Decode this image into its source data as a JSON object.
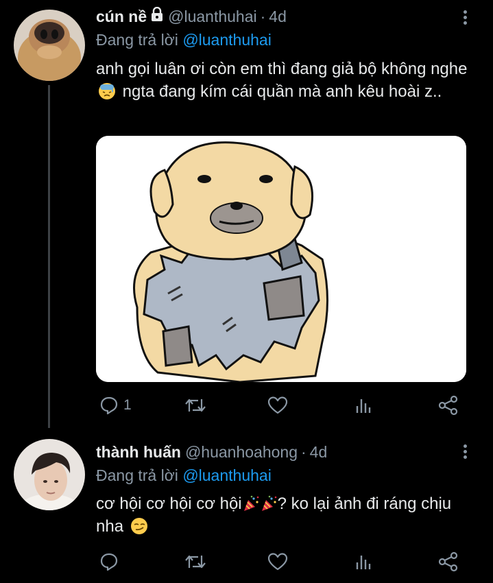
{
  "tweets": [
    {
      "name": "cún nề",
      "handle": "@luanthuhai",
      "separator": "·",
      "time": "4d",
      "replying_prefix": "Đang trả lời",
      "replying_to": "@luanthuhai",
      "text_parts": [
        "anh gọi luân ơi còn em thì đang giả bộ không nghe",
        " ngta đang kím cái quần mà anh kêu hoài z.."
      ],
      "emojis": [
        "anxious-face-emoji"
      ],
      "reply_count": "1",
      "has_media": true,
      "locked": true
    },
    {
      "name": "thành huấn",
      "handle": "@huanhoahong",
      "separator": "·",
      "time": "4d",
      "replying_prefix": "Đang trả lời",
      "replying_to": "@luanthuhai",
      "text_parts": [
        "cơ hội cơ hội cơ hội",
        "? ko lại ảnh đi ráng chịu nha "
      ],
      "emojis": [
        "party-popper-emoji",
        "party-popper-emoji",
        "smirking-face-emoji"
      ],
      "reply_count": "",
      "has_media": false,
      "locked": false
    }
  ],
  "colors": {
    "background": "#000000",
    "secondary_text": "#8b98a5",
    "accent": "#1d9bf0",
    "primary_text": "#e7e9ea"
  }
}
